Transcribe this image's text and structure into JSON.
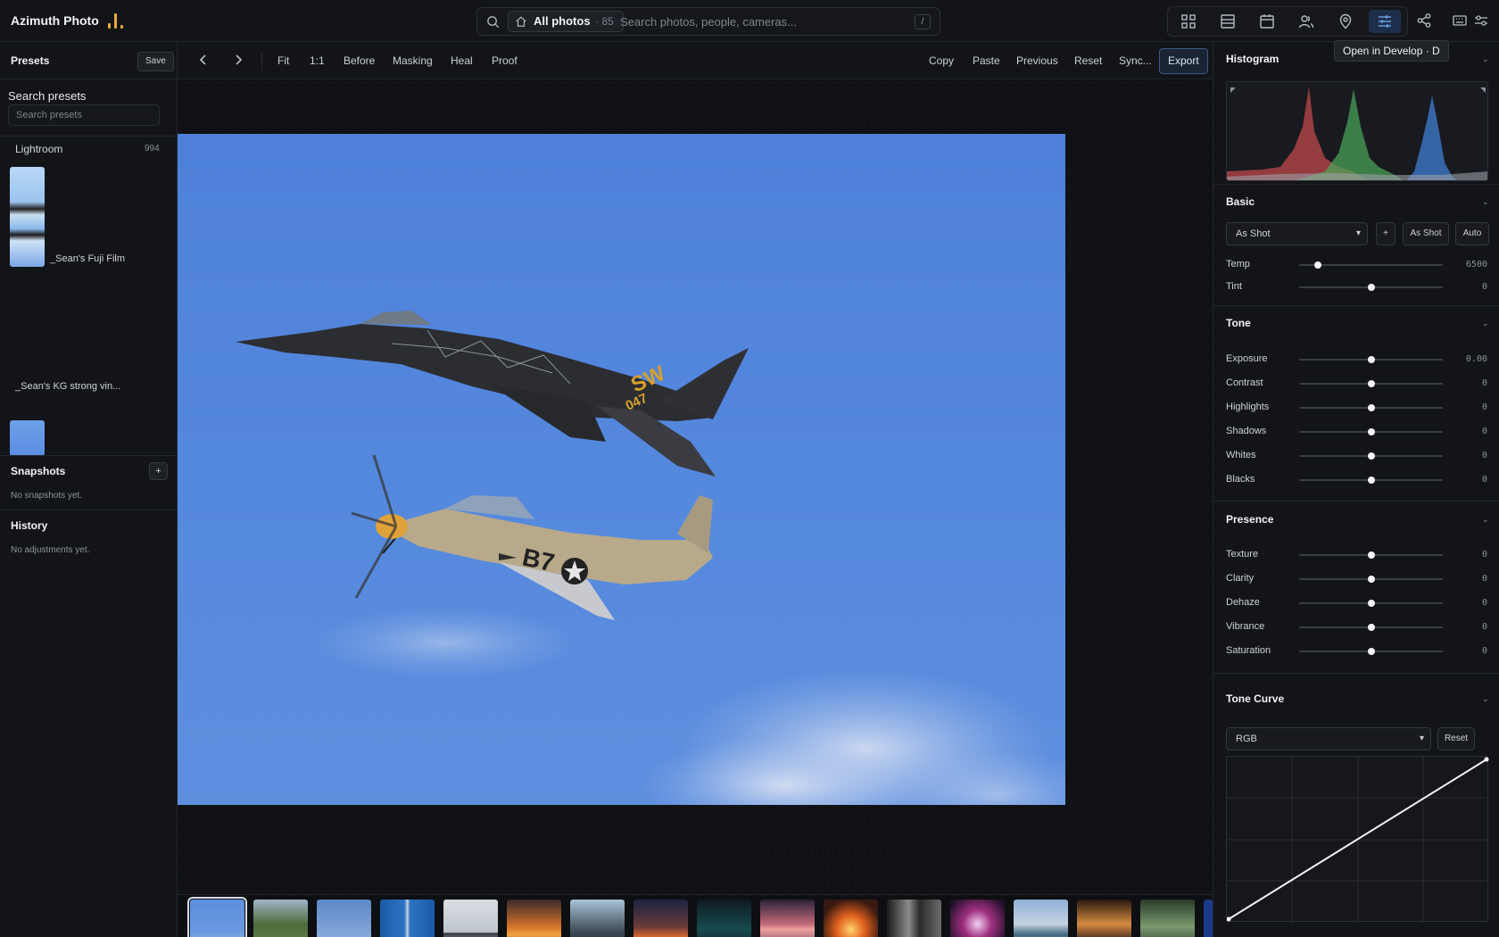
{
  "app": {
    "title": "Azimuth Photo"
  },
  "search": {
    "scope_label": "All photos",
    "scope_count": "· 85",
    "placeholder": "Search photos, people, cameras...",
    "shortcut": "/"
  },
  "toolbar": {
    "tooltip": "Open in Develop · D",
    "icons": [
      "grid-icon",
      "list-icon",
      "calendar-icon",
      "people-icon",
      "map-pin-icon",
      "develop-sliders-icon",
      "share-icon"
    ],
    "active": "develop-sliders-icon",
    "extra_icons": [
      "keyboard-icon",
      "settings-icon"
    ]
  },
  "left": {
    "presets_title": "Presets",
    "save_label": "Save",
    "search_label": "Search presets",
    "search_placeholder": "Search presets",
    "group": {
      "name": "Lightroom",
      "count": "994"
    },
    "presets": [
      "_Sean's Fuji Film",
      "_Sean's KG strong vin..."
    ],
    "snapshots_title": "Snapshots",
    "snapshots_add": "+",
    "snapshots_empty": "No snapshots yet.",
    "history_title": "History",
    "history_empty": "No adjustments yet."
  },
  "center": {
    "nav": {
      "prev": "‹",
      "next": "›"
    },
    "tools": [
      "Fit",
      "1:1",
      "Before",
      "Masking",
      "Heal",
      "Proof"
    ],
    "actions": [
      "Copy",
      "Paste",
      "Previous",
      "Reset",
      "Sync..."
    ],
    "export_label": "Export"
  },
  "right": {
    "histogram_title": "Histogram",
    "basic": {
      "title": "Basic",
      "wb_select": "As Shot",
      "plus_label": "+",
      "as_shot_label": "As Shot",
      "auto_label": "Auto",
      "sliders": [
        {
          "label": "Temp",
          "value": "6500",
          "position": 0.13
        },
        {
          "label": "Tint",
          "value": "0",
          "position": 0.5
        }
      ]
    },
    "tone": {
      "title": "Tone",
      "sliders": [
        {
          "label": "Exposure",
          "value": "0.00",
          "position": 0.5
        },
        {
          "label": "Contrast",
          "value": "0",
          "position": 0.5
        },
        {
          "label": "Highlights",
          "value": "0",
          "position": 0.5
        },
        {
          "label": "Shadows",
          "value": "0",
          "position": 0.5
        },
        {
          "label": "Whites",
          "value": "0",
          "position": 0.5
        },
        {
          "label": "Blacks",
          "value": "0",
          "position": 0.5
        }
      ]
    },
    "presence": {
      "title": "Presence",
      "sliders": [
        {
          "label": "Texture",
          "value": "0",
          "position": 0.5
        },
        {
          "label": "Clarity",
          "value": "0",
          "position": 0.5
        },
        {
          "label": "Dehaze",
          "value": "0",
          "position": 0.5
        },
        {
          "label": "Vibrance",
          "value": "0",
          "position": 0.5
        },
        {
          "label": "Saturation",
          "value": "0",
          "position": 0.5
        }
      ]
    },
    "tone_curve": {
      "title": "Tone Curve",
      "channel": "RGB",
      "reset_label": "Reset"
    },
    "chevron": "⌄"
  },
  "filmstrip": {
    "count": 17,
    "selected_index": 0
  }
}
